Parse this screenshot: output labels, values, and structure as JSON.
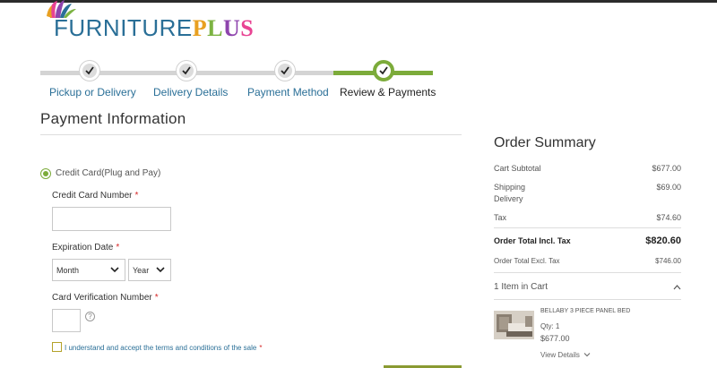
{
  "brand": {
    "name_part1": "FURNITURE",
    "name_part2": [
      "P",
      "L",
      "U",
      "S"
    ]
  },
  "steps": [
    {
      "label": "Pickup or Delivery",
      "state": "complete"
    },
    {
      "label": "Delivery Details",
      "state": "complete"
    },
    {
      "label": "Payment Method",
      "state": "complete"
    },
    {
      "label": "Review & Payments",
      "state": "active"
    }
  ],
  "payment": {
    "title": "Payment Information",
    "method_label": "Credit Card(Plug and Pay)",
    "card_number_label": "Credit Card Number",
    "expiration_label": "Expiration Date",
    "month_value": "Month",
    "year_value": "Year",
    "cvv_label": "Card Verification Number",
    "help_glyph": "?",
    "required_mark": "*",
    "terms_text": "I understand and accept the terms and conditions of the sale"
  },
  "summary": {
    "title": "Order Summary",
    "cart_subtotal_label": "Cart Subtotal",
    "cart_subtotal": "$677.00",
    "shipping_label": "Shipping",
    "shipping_method": "Delivery",
    "shipping": "$69.00",
    "tax_label": "Tax",
    "tax": "$74.60",
    "total_incl_label": "Order Total Incl. Tax",
    "total_incl": "$820.60",
    "total_excl_label": "Order Total Excl. Tax",
    "total_excl": "$746.00",
    "items_label": "1 Item in Cart"
  },
  "cart_item": {
    "name": "BELLABY 3 PIECE PANEL BED",
    "qty": "Qty: 1",
    "price": "$677.00",
    "view_details": "View Details"
  },
  "colors": {
    "accent": "#7cab3a",
    "link": "#2a6f97",
    "required": "#d62828"
  },
  "icons": [
    "logo-mark-icon",
    "checkmark-icon",
    "chevron-down-icon",
    "help-icon",
    "chevron-up-icon"
  ]
}
